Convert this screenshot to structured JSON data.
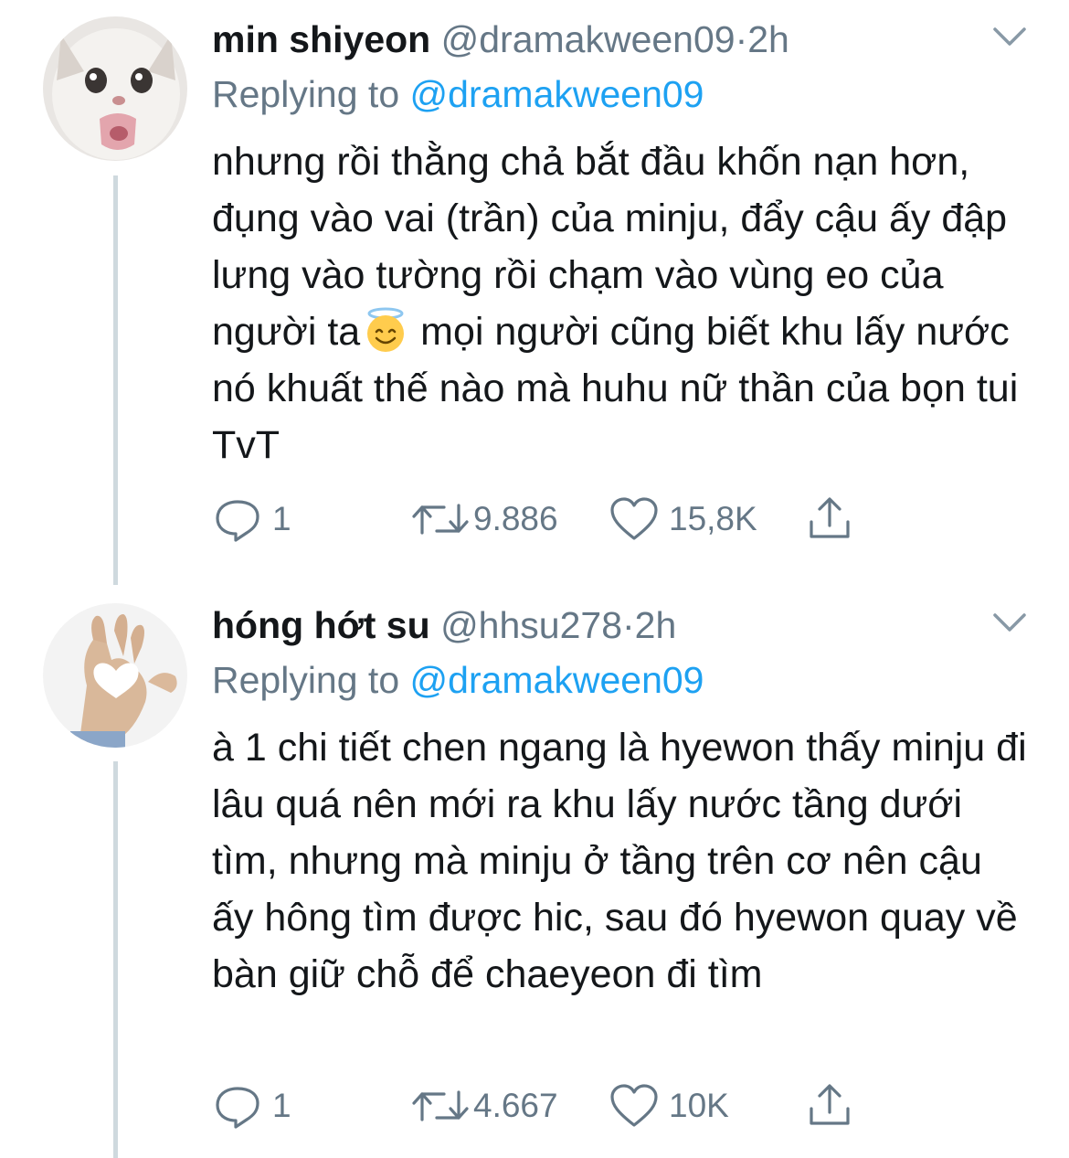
{
  "tweets": [
    {
      "name": "min shiyeon",
      "handle": "@dramakween09",
      "separator": "·",
      "time": "2h",
      "replying_prefix": "Replying to",
      "replying_to": "@dramakween09",
      "text_before_emoji": "nhưng rồi thằng chả bắt đầu khốn nạn hơn, đụng vào vai (trần) của minju, đẩy cậu ấy đập lưng vào tường rồi chạm vào vùng eo của người ta",
      "text_after_emoji": " mọi người cũng biết khu lấy nước nó khuất thế nào mà huhu nữ thần của bọn tui TvT",
      "emoji_icon": "smiling-face-with-halo-icon",
      "replies": "1",
      "retweets": "9.886",
      "likes": "15,8K"
    },
    {
      "name": "hóng hớt su",
      "handle": "@hhsu278",
      "separator": "·",
      "time": "2h",
      "replying_prefix": "Replying to",
      "replying_to": "@dramakween09",
      "text": "à 1 chi tiết chen ngang là hyewon thấy minju đi lâu quá nên mới ra khu lấy nước tầng dưới tìm, nhưng mà minju ở tầng trên cơ nên cậu ấy hông tìm được hic, sau đó hyewon quay về bàn giữ chỗ để chaeyeon đi tìm",
      "replies": "1",
      "retweets": "4.667",
      "likes": "10K"
    }
  ],
  "icons": {
    "reply": "reply-icon",
    "retweet": "retweet-icon",
    "like": "heart-icon",
    "share": "share-icon",
    "menu": "chevron-down-icon"
  },
  "colors": {
    "text": "#14171a",
    "secondary": "#657786",
    "link": "#1da1f2",
    "thread_line": "#cfd9de"
  }
}
